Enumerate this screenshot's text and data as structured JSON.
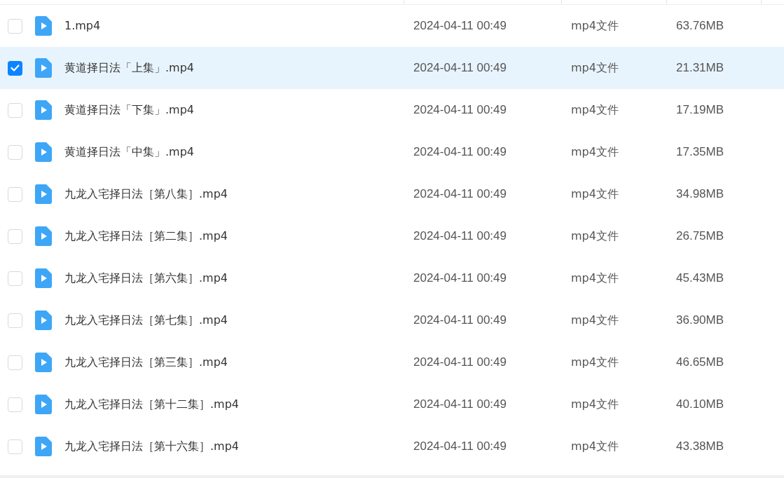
{
  "files": [
    {
      "name": "1.mp4",
      "date": "2024-04-11 00:49",
      "type": "mp4文件",
      "size": "63.76MB",
      "selected": false
    },
    {
      "name": "黄道择日法「上集」.mp4",
      "date": "2024-04-11 00:49",
      "type": "mp4文件",
      "size": "21.31MB",
      "selected": true
    },
    {
      "name": "黄道择日法「下集」.mp4",
      "date": "2024-04-11 00:49",
      "type": "mp4文件",
      "size": "17.19MB",
      "selected": false
    },
    {
      "name": "黄道择日法「中集」.mp4",
      "date": "2024-04-11 00:49",
      "type": "mp4文件",
      "size": "17.35MB",
      "selected": false
    },
    {
      "name": "九龙入宅择日法［第八集］.mp4",
      "date": "2024-04-11 00:49",
      "type": "mp4文件",
      "size": "34.98MB",
      "selected": false
    },
    {
      "name": "九龙入宅择日法［第二集］.mp4",
      "date": "2024-04-11 00:49",
      "type": "mp4文件",
      "size": "26.75MB",
      "selected": false
    },
    {
      "name": "九龙入宅择日法［第六集］.mp4",
      "date": "2024-04-11 00:49",
      "type": "mp4文件",
      "size": "45.43MB",
      "selected": false
    },
    {
      "name": "九龙入宅择日法［第七集］.mp4",
      "date": "2024-04-11 00:49",
      "type": "mp4文件",
      "size": "36.90MB",
      "selected": false
    },
    {
      "name": "九龙入宅择日法［第三集］.mp4",
      "date": "2024-04-11 00:49",
      "type": "mp4文件",
      "size": "46.65MB",
      "selected": false
    },
    {
      "name": "九龙入宅择日法［第十二集］.mp4",
      "date": "2024-04-11 00:49",
      "type": "mp4文件",
      "size": "40.10MB",
      "selected": false
    },
    {
      "name": "九龙入宅择日法［第十六集］.mp4",
      "date": "2024-04-11 00:49",
      "type": "mp4文件",
      "size": "43.38MB",
      "selected": false
    }
  ]
}
